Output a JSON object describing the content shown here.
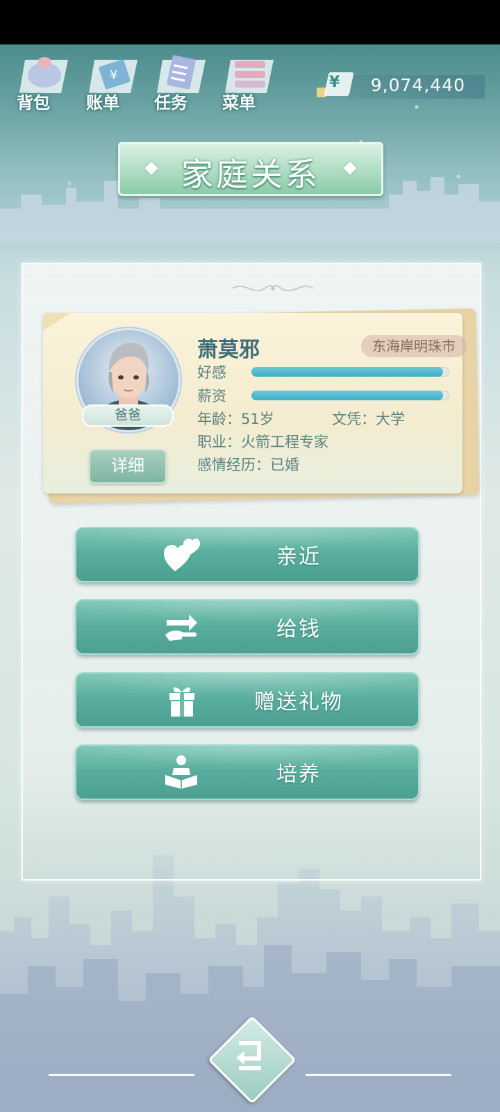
{
  "top_nav": [
    {
      "label": "背包",
      "icon": "backpack-icon"
    },
    {
      "label": "账单",
      "icon": "bill-icon"
    },
    {
      "label": "任务",
      "icon": "task-icon"
    },
    {
      "label": "菜单",
      "icon": "menu-icon"
    }
  ],
  "currency": {
    "symbol": "¥",
    "amount": "9,074,440"
  },
  "title": "家庭关系",
  "profile": {
    "name": "萧莫邪",
    "location": "东海岸明珠市",
    "relation": "爸爸",
    "detail_label": "详细",
    "affection_label": "好感",
    "affection_level": 0.97,
    "salary_label": "薪资",
    "salary_level": 0.97,
    "age": "年龄：51岁",
    "education": "文凭：大学",
    "occupation": "职业：火箭工程专家",
    "relationship": "感情经历：已婚"
  },
  "actions": [
    {
      "label": "亲近",
      "icon": "hearts-icon"
    },
    {
      "label": "给钱",
      "icon": "money-transfer-icon"
    },
    {
      "label": "赠送礼物",
      "icon": "gift-icon"
    },
    {
      "label": "培养",
      "icon": "reading-person-icon"
    }
  ],
  "colors": {
    "accent": "#58ad9e",
    "bar_fill": "#3fb0c7",
    "title_text": "#3f6e76"
  }
}
